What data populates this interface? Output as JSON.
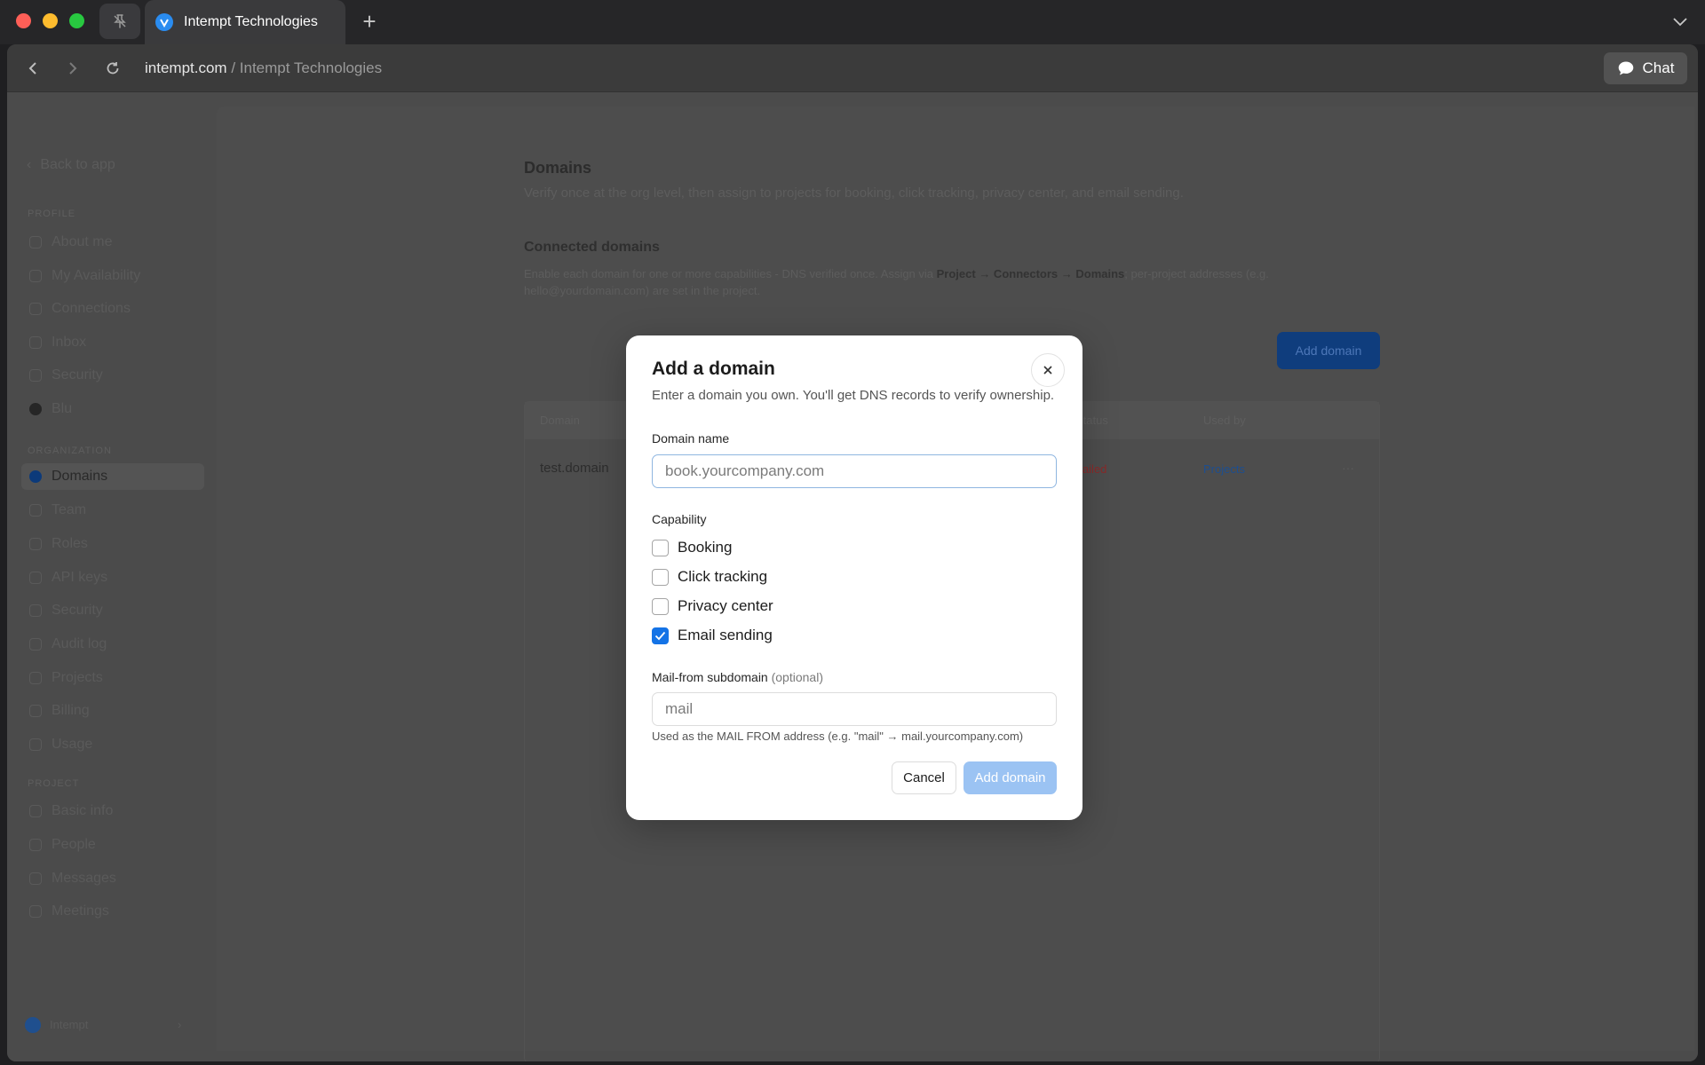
{
  "tab": {
    "title": "Intempt Technologies"
  },
  "addressbar": {
    "host": "intempt.com",
    "path": " / Intempt Technologies"
  },
  "chat_button": {
    "label": "Chat"
  },
  "sidebar": {
    "back": "Back to app",
    "profile_label": "PROFILE",
    "profile_items": [
      "About me",
      "My Availability",
      "Connections",
      "Inbox",
      "Security",
      "Blu"
    ],
    "org_label": "ORGANIZATION",
    "org_items": [
      "Domains",
      "Team",
      "Roles",
      "API keys",
      "Security",
      "Audit log",
      "Projects",
      "Billing",
      "Usage"
    ],
    "project_label": "PROJECT",
    "project_items": [
      "Basic info",
      "People",
      "Messages",
      "Meetings"
    ],
    "footer": "Intempt"
  },
  "background": {
    "title": "Domains",
    "description": "Verify once at the org level, then assign to projects for booking, click tracking, privacy center, and email sending.",
    "connected_title": "Connected domains",
    "connected_desc_1": "Enable each domain for one or more capabilities - DNS verified once. Assign via ",
    "connected_desc_bold": "Project → Connectors → Domains",
    "connected_desc_2": "; per-project addresses (e.g. hello@yourdomain.com) are set in the project.",
    "add_button": "Add domain",
    "table_headers": [
      "Domain",
      "Status",
      "Used by"
    ],
    "row": {
      "domain": "test.domain",
      "status": "Failed",
      "used_by": "Projects",
      "menu": "···"
    }
  },
  "modal": {
    "title": "Add a domain",
    "subtitle": "Enter a domain you own. You'll get DNS records to verify ownership.",
    "domain_label": "Domain name",
    "domain_placeholder": "book.yourcompany.com",
    "capability_label": "Capability",
    "capabilities": [
      {
        "label": "Booking",
        "checked": false
      },
      {
        "label": "Click tracking",
        "checked": false
      },
      {
        "label": "Privacy center",
        "checked": false
      },
      {
        "label": "Email sending",
        "checked": true
      }
    ],
    "mail_from_label": "Mail-from subdomain",
    "mail_from_optional": "(optional)",
    "mail_from_placeholder": "mail",
    "mail_from_help": "Used as the MAIL FROM address (e.g. \"mail\" → mail.yourcompany.com)",
    "cancel": "Cancel",
    "submit": "Add domain"
  },
  "colors": {
    "accent": "#1473e6",
    "submit_disabled": "#9bc3f3",
    "failed": "#8a2a2a",
    "link": "#1d4e90"
  }
}
